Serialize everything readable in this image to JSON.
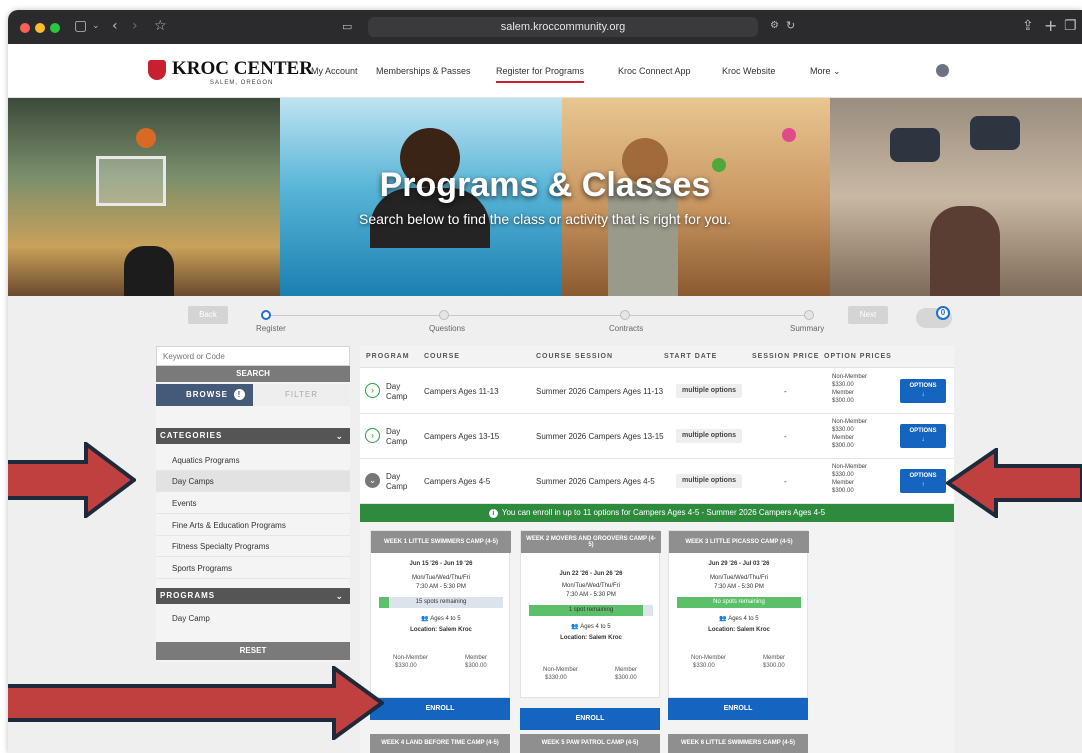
{
  "browser": {
    "url": "salem.kroccommunity.org",
    "colors": {
      "chrome": "#2b2b2d",
      "close": "#ff5f57",
      "minimize": "#febc2e",
      "zoom": "#28c840"
    }
  },
  "nav": {
    "logo_name": "KROC CENTER",
    "logo_sub": "SALEM, OREGON",
    "links": [
      "My Account",
      "Memberships & Passes",
      "Register for Programs",
      "Kroc Connect App",
      "Kroc Website",
      "More"
    ],
    "active_link": "Register for Programs",
    "brand_color": "#c8202f"
  },
  "hero": {
    "title": "Programs & Classes",
    "subtitle": "Search below to find the class or activity that is right for you."
  },
  "steps": {
    "back_label": "Back",
    "next_label": "Next",
    "items": [
      "Register",
      "Questions",
      "Contracts",
      "Summary"
    ],
    "cart_count": "0"
  },
  "sidebar": {
    "keyword_placeholder": "Keyword or Code",
    "search_label": "SEARCH",
    "browse_label": "BROWSE",
    "filter_label": "FILTER",
    "categories_label": "CATEGORIES",
    "categories": [
      "Aquatics Programs",
      "Day Camps",
      "Events",
      "Fine Arts & Education Programs",
      "Fitness Specialty Programs",
      "Sports Programs"
    ],
    "selected_category": "Day Camps",
    "programs_label": "PROGRAMS",
    "programs": [
      "Day Camp"
    ],
    "reset_label": "RESET"
  },
  "table": {
    "headers": [
      "PROGRAM",
      "COURSE",
      "COURSE SESSION",
      "START DATE",
      "SESSION PRICE",
      "OPTION PRICES"
    ],
    "rows": [
      {
        "program_line1": "Day",
        "program_line2": "Camp",
        "course": "Campers Ages 11-13",
        "session": "Summer 2026 Campers Ages 11-13",
        "start": "multiple options",
        "session_price": "-",
        "nonmember_label": "Non-Member",
        "nonmember_price": "$330.00",
        "member_label": "Member",
        "member_price": "$300.00",
        "option_label": "OPTIONS",
        "option_glyph": "↓"
      },
      {
        "program_line1": "Day",
        "program_line2": "Camp",
        "course": "Campers Ages 13-15",
        "session": "Summer 2026 Campers Ages 13-15",
        "start": "multiple options",
        "session_price": "-",
        "nonmember_label": "Non-Member",
        "nonmember_price": "$330.00",
        "member_label": "Member",
        "member_price": "$300.00",
        "option_label": "OPTIONS",
        "option_glyph": "↓"
      },
      {
        "program_line1": "Day",
        "program_line2": "Camp",
        "course": "Campers Ages 4-5",
        "session": "Summer 2026 Campers Ages 4-5",
        "start": "multiple options",
        "session_price": "-",
        "nonmember_label": "Non-Member",
        "nonmember_price": "$330.00",
        "member_label": "Member",
        "member_price": "$300.00",
        "option_label": "OPTIONS",
        "option_glyph": "↑"
      }
    ],
    "banner": "You can enroll in up to 11 options for Campers Ages 4-5 - Summer 2026 Campers Ages 4-5",
    "banner_color": "#2e8b3e",
    "button_color": "#1565c0"
  },
  "camps": [
    {
      "title": "WEEK 1 LITTLE SWIMMERS CAMP (4-5)",
      "dates": "Jun 15 '26 - Jun 19 '26",
      "days": "Mon/Tue/Wed/Thu/Fri",
      "time": "7:30 AM - 5:30 PM",
      "spots": "15 spots remaining",
      "ages": "Ages 4 to 5",
      "location": "Location: Salem Kroc",
      "nonmember_label": "Non-Member",
      "nonmember_price": "$330.00",
      "member_label": "Member",
      "member_price": "$300.00",
      "enroll_label": "ENROLL"
    },
    {
      "title": "WEEK 2 MOVERS AND GROOVERS CAMP (4-5)",
      "dates": "Jun 22 '26 - Jun 26 '26",
      "days": "Mon/Tue/Wed/Thu/Fri",
      "time": "7:30 AM - 5:30 PM",
      "spots": "1 spot remaining",
      "ages": "Ages 4 to 5",
      "location": "Location: Salem Kroc",
      "nonmember_label": "Non-Member",
      "nonmember_price": "$330.00",
      "member_label": "Member",
      "member_price": "$300.00",
      "enroll_label": "ENROLL"
    },
    {
      "title": "WEEK 3 LITTLE PICASSO CAMP (4-5)",
      "dates": "Jun 29 '26 - Jul 03 '26",
      "days": "Mon/Tue/Wed/Thu/Fri",
      "time": "7:30 AM - 5:30 PM",
      "spots": "No spots remaining",
      "ages": "Ages 4 to 5",
      "location": "Location: Salem Kroc",
      "nonmember_label": "Non-Member",
      "nonmember_price": "$330.00",
      "member_label": "Member",
      "member_price": "$300.00",
      "enroll_label": "ENROLL"
    }
  ],
  "next_camps": [
    "WEEK 4 LAND BEFORE TIME CAMP (4-5)",
    "WEEK 5 PAW PATROL CAMP (4-5)",
    "WEEK 6 LITTLE SWIMMERS CAMP (4-5)"
  ],
  "annotation_color": "#c0403f"
}
